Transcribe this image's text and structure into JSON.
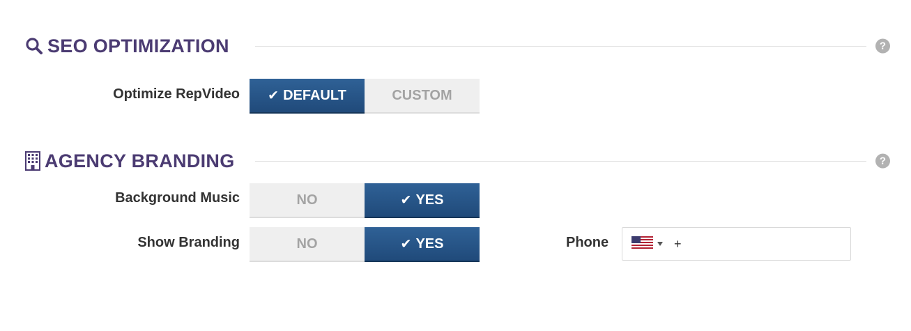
{
  "seo": {
    "title": "SEO OPTIMIZATION",
    "icon": "search-icon",
    "help": "?",
    "rows": {
      "optimize": {
        "label": "Optimize RepVideo",
        "options": [
          "DEFAULT",
          "CUSTOM"
        ],
        "selected": "DEFAULT"
      }
    }
  },
  "branding": {
    "title": "AGENCY BRANDING",
    "icon": "building-icon",
    "help": "?",
    "rows": {
      "music": {
        "label": "Background Music",
        "options": [
          "NO",
          "YES"
        ],
        "selected": "YES"
      },
      "show": {
        "label": "Show Branding",
        "options": [
          "NO",
          "YES"
        ],
        "selected": "YES"
      }
    },
    "phone": {
      "label": "Phone",
      "country_flag": "us-flag-icon",
      "value": "+"
    }
  },
  "colors": {
    "accent_title": "#4b3b72",
    "toggle_active": "#245183",
    "toggle_inactive": "#efefef"
  }
}
